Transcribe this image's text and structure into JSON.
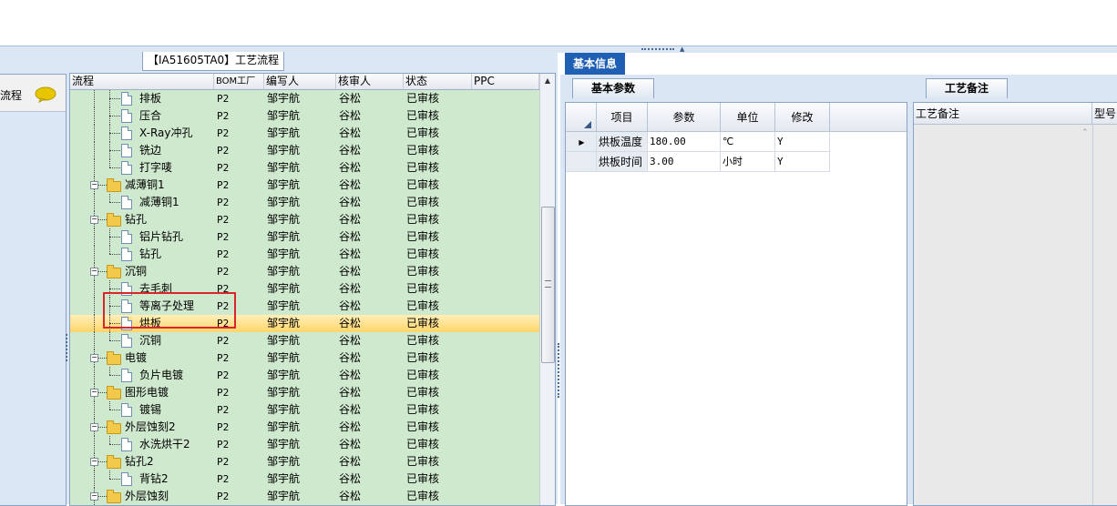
{
  "flow_caption": "【IA51605TA0】工艺流程",
  "left_sub_label": "流程",
  "tree": {
    "columns": [
      "流程",
      "BOM工厂",
      "编写人",
      "核审人",
      "状态",
      "PPC"
    ],
    "rows": [
      {
        "name": "排板",
        "bom": "P2",
        "writer": "邹宇航",
        "reviewer": "谷松",
        "status": "已审核",
        "level": 1
      },
      {
        "name": "压合",
        "bom": "P2",
        "writer": "邹宇航",
        "reviewer": "谷松",
        "status": "已审核",
        "level": 1
      },
      {
        "name": "X-Ray冲孔",
        "bom": "P2",
        "writer": "邹宇航",
        "reviewer": "谷松",
        "status": "已审核",
        "level": 1
      },
      {
        "name": "铣边",
        "bom": "P2",
        "writer": "邹宇航",
        "reviewer": "谷松",
        "status": "已审核",
        "level": 1
      },
      {
        "name": "打字唛",
        "bom": "P2",
        "writer": "邹宇航",
        "reviewer": "谷松",
        "status": "已审核",
        "level": 1
      },
      {
        "name": "减薄铜1",
        "bom": "P2",
        "writer": "邹宇航",
        "reviewer": "谷松",
        "status": "已审核",
        "level": 0
      },
      {
        "name": "减薄铜1",
        "bom": "P2",
        "writer": "邹宇航",
        "reviewer": "谷松",
        "status": "已审核",
        "level": 1
      },
      {
        "name": "钻孔",
        "bom": "P2",
        "writer": "邹宇航",
        "reviewer": "谷松",
        "status": "已审核",
        "level": 0
      },
      {
        "name": "铝片钻孔",
        "bom": "P2",
        "writer": "邹宇航",
        "reviewer": "谷松",
        "status": "已审核",
        "level": 1
      },
      {
        "name": "钻孔",
        "bom": "P2",
        "writer": "邹宇航",
        "reviewer": "谷松",
        "status": "已审核",
        "level": 1
      },
      {
        "name": "沉铜",
        "bom": "P2",
        "writer": "邹宇航",
        "reviewer": "谷松",
        "status": "已审核",
        "level": 0
      },
      {
        "name": "去毛刺",
        "bom": "P2",
        "writer": "邹宇航",
        "reviewer": "谷松",
        "status": "已审核",
        "level": 1
      },
      {
        "name": "等离子处理",
        "bom": "P2",
        "writer": "邹宇航",
        "reviewer": "谷松",
        "status": "已审核",
        "level": 1
      },
      {
        "name": "烘板",
        "bom": "P2",
        "writer": "邹宇航",
        "reviewer": "谷松",
        "status": "已审核",
        "level": 1,
        "selected": true
      },
      {
        "name": "沉铜",
        "bom": "P2",
        "writer": "邹宇航",
        "reviewer": "谷松",
        "status": "已审核",
        "level": 1
      },
      {
        "name": "电镀",
        "bom": "P2",
        "writer": "邹宇航",
        "reviewer": "谷松",
        "status": "已审核",
        "level": 0
      },
      {
        "name": "负片电镀",
        "bom": "P2",
        "writer": "邹宇航",
        "reviewer": "谷松",
        "status": "已审核",
        "level": 1
      },
      {
        "name": "图形电镀",
        "bom": "P2",
        "writer": "邹宇航",
        "reviewer": "谷松",
        "status": "已审核",
        "level": 0
      },
      {
        "name": "镀锡",
        "bom": "P2",
        "writer": "邹宇航",
        "reviewer": "谷松",
        "status": "已审核",
        "level": 1
      },
      {
        "name": "外层蚀刻2",
        "bom": "P2",
        "writer": "邹宇航",
        "reviewer": "谷松",
        "status": "已审核",
        "level": 0
      },
      {
        "name": "水洗烘干2",
        "bom": "P2",
        "writer": "邹宇航",
        "reviewer": "谷松",
        "status": "已审核",
        "level": 1
      },
      {
        "name": "钻孔2",
        "bom": "P2",
        "writer": "邹宇航",
        "reviewer": "谷松",
        "status": "已审核",
        "level": 0
      },
      {
        "name": "背钻2",
        "bom": "P2",
        "writer": "邹宇航",
        "reviewer": "谷松",
        "status": "已审核",
        "level": 1
      },
      {
        "name": "外层蚀刻",
        "bom": "P2",
        "writer": "邹宇航",
        "reviewer": "谷松",
        "status": "已审核",
        "level": 0
      }
    ]
  },
  "basic_info_tab": "基本信息",
  "params": {
    "tab": "基本参数",
    "columns": [
      "项目",
      "参数",
      "单位",
      "修改"
    ],
    "rows": [
      {
        "item": "烘板温度",
        "value": "180.00",
        "unit": "℃",
        "modify": "Y",
        "current": true
      },
      {
        "item": "烘板时间",
        "value": "3.00",
        "unit": "小时",
        "modify": "Y",
        "current": false
      }
    ]
  },
  "remarks": {
    "tab": "工艺备注",
    "columns": [
      "工艺备注",
      "型号"
    ]
  },
  "colors": {
    "tree_bg": "#cfe9cf",
    "selected_row": "#ffd56b",
    "highlight_box": "#d9262b",
    "tab_active": "#1f5fb4"
  }
}
